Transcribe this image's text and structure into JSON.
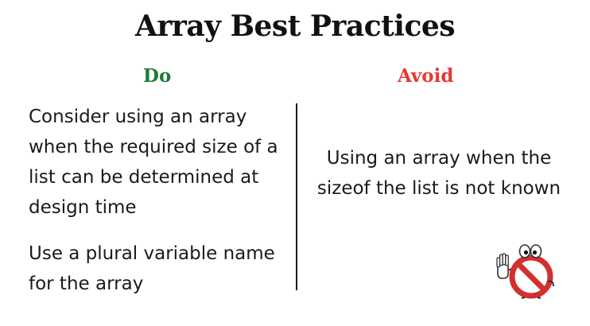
{
  "slide": {
    "title": "Array Best Practices"
  },
  "do": {
    "heading": "Do",
    "items": [
      "Consider using an array when the required size of a list can be determined at design time",
      "Use a plural variable name for the array"
    ]
  },
  "avoid": {
    "heading": "Avoid",
    "text": "Using an array when the sizeof the list is not known"
  },
  "colors": {
    "do_heading": "#1f7a3a",
    "avoid_heading": "#e53935",
    "stop_sign": "#d32f2f"
  },
  "icons": {
    "stop_mascot": "stop-sign-mascot-icon"
  }
}
